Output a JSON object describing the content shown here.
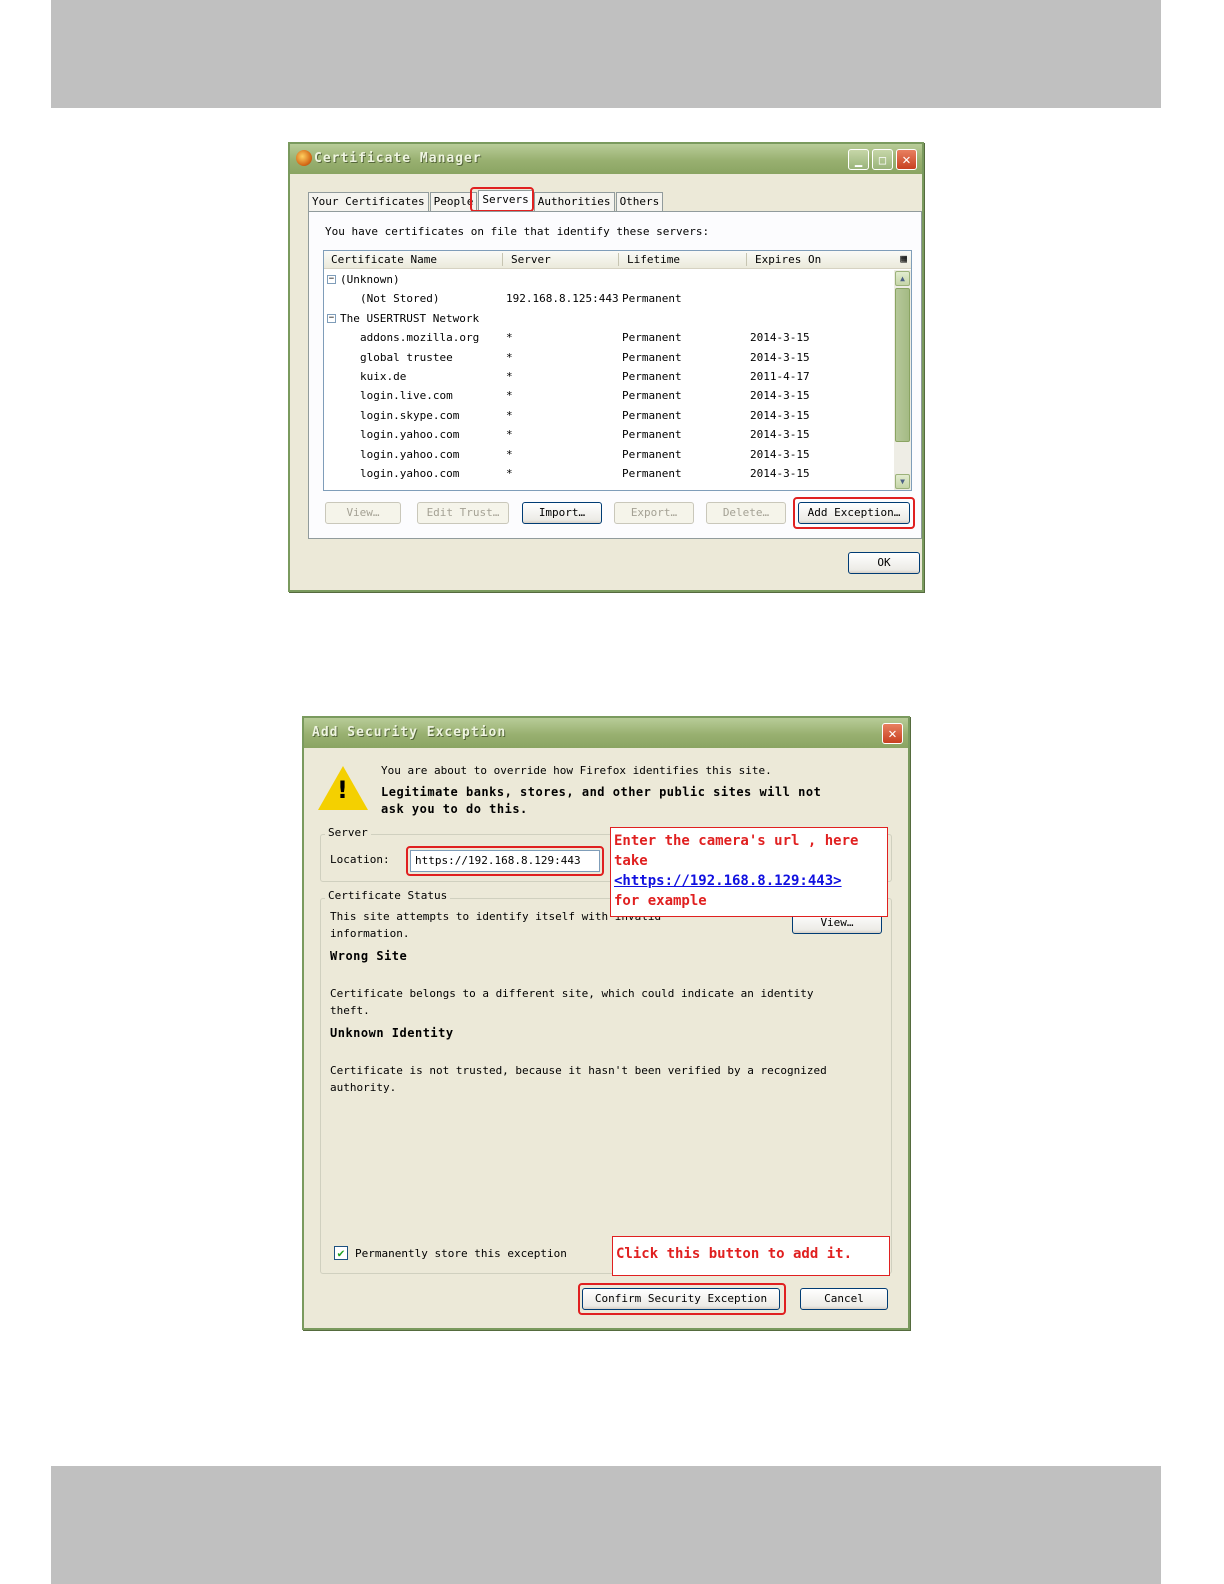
{
  "cert_manager": {
    "title": "Certificate Manager",
    "tabs": [
      "Your Certificates",
      "People",
      "Servers",
      "Authorities",
      "Others"
    ],
    "active_tab": "Servers",
    "description": "You have certificates on file that identify these servers:",
    "columns": [
      "Certificate Name",
      "Server",
      "Lifetime",
      "Expires On"
    ],
    "groups": [
      {
        "name": "(Unknown)",
        "rows": [
          {
            "name": "(Not Stored)",
            "server": "192.168.8.125:443",
            "lifetime": "Permanent",
            "expires": ""
          }
        ]
      },
      {
        "name": "The USERTRUST Network",
        "rows": [
          {
            "name": "addons.mozilla.org",
            "server": "*",
            "lifetime": "Permanent",
            "expires": "2014-3-15"
          },
          {
            "name": "global trustee",
            "server": "*",
            "lifetime": "Permanent",
            "expires": "2014-3-15"
          },
          {
            "name": "kuix.de",
            "server": "*",
            "lifetime": "Permanent",
            "expires": "2011-4-17"
          },
          {
            "name": "login.live.com",
            "server": "*",
            "lifetime": "Permanent",
            "expires": "2014-3-15"
          },
          {
            "name": "login.skype.com",
            "server": "*",
            "lifetime": "Permanent",
            "expires": "2014-3-15"
          },
          {
            "name": "login.yahoo.com",
            "server": "*",
            "lifetime": "Permanent",
            "expires": "2014-3-15"
          },
          {
            "name": "login.yahoo.com",
            "server": "*",
            "lifetime": "Permanent",
            "expires": "2014-3-15"
          },
          {
            "name": "login.yahoo.com",
            "server": "*",
            "lifetime": "Permanent",
            "expires": "2014-3-15"
          }
        ]
      }
    ],
    "buttons": {
      "view": "View…",
      "edit_trust": "Edit Trust…",
      "import": "Import…",
      "export": "Export…",
      "delete": "Delete…",
      "add_exception": "Add Exception…",
      "ok": "OK"
    }
  },
  "security_exception": {
    "title": "Add Security Exception",
    "warning_line": "You are about to override how Firefox identifies this site.",
    "warning_bold_1": "Legitimate banks, stores, and other public sites will not",
    "warning_bold_2": "ask you to do this.",
    "server_group": "Server",
    "location_label": "Location:",
    "location_value": "https://192.168.8.129:443",
    "status_group": "Certificate Status",
    "status_line_1": "This site attempts to identify itself with invalid",
    "status_line_2": "information.",
    "view_button": "View…",
    "wrong_site_heading": "Wrong Site",
    "wrong_site_1": "Certificate belongs to a different site, which could indicate an identity",
    "wrong_site_2": "theft.",
    "unknown_heading": "Unknown Identity",
    "unknown_1": "Certificate is not trusted, because it hasn't been verified by a recognized",
    "unknown_2": "authority.",
    "permanent_label": "Permanently store this exception",
    "permanent_checked": true,
    "confirm_button": "Confirm Security Exception",
    "cancel_button": "Cancel"
  },
  "annotations": {
    "url_note_1": "Enter the camera's url , here",
    "url_note_2": "take",
    "url_note_link": "<https://192.168.8.129:443>",
    "url_note_3": "for example",
    "click_note": "Click this button to add it."
  },
  "icons": {
    "close": "✕",
    "minimize": "▁",
    "maximize": "□",
    "collapse": "⊟",
    "warning": "!",
    "check": "✔",
    "scroll_up": "▲",
    "scroll_down": "▼",
    "column_picker": "▦"
  },
  "colors": {
    "highlight": "#e02020",
    "title_bar": "#98b070",
    "link": "#1010e0"
  }
}
